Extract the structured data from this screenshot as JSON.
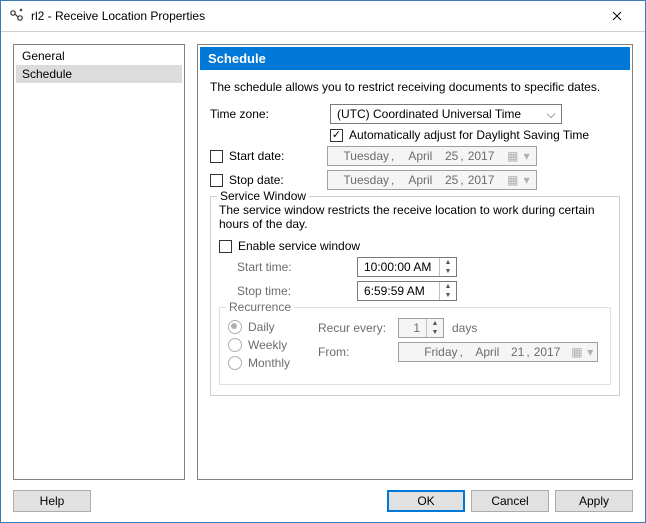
{
  "window": {
    "title": "rl2 - Receive Location Properties"
  },
  "sidebar": {
    "items": [
      {
        "label": "General",
        "selected": false
      },
      {
        "label": "Schedule",
        "selected": true
      }
    ]
  },
  "schedule": {
    "header": "Schedule",
    "description": "The schedule allows you to restrict receiving documents to specific dates.",
    "timezone": {
      "label": "Time zone:",
      "value": "(UTC) Coordinated Universal Time"
    },
    "dst": {
      "checked": true,
      "label": "Automatically adjust for Daylight Saving Time"
    },
    "startDate": {
      "checked": false,
      "label": "Start date:",
      "weekday": "Tuesday",
      "month": "April",
      "day": "25",
      "year": "2017"
    },
    "stopDate": {
      "checked": false,
      "label": "Stop date:",
      "weekday": "Tuesday",
      "month": "April",
      "day": "25",
      "year": "2017"
    },
    "serviceWindow": {
      "legend": "Service Window",
      "description": "The service window restricts the receive location to work during certain hours of the day.",
      "enableLabel": "Enable service window",
      "enabled": false,
      "startTime": {
        "label": "Start time:",
        "value": "10:00:00 AM"
      },
      "stopTime": {
        "label": "Stop time:",
        "value": "6:59:59 AM"
      }
    },
    "recurrence": {
      "legend": "Recurrence",
      "options": [
        "Daily",
        "Weekly",
        "Monthly"
      ],
      "selected": "Daily",
      "everyLabel": "Recur every:",
      "everyValue": "1",
      "everyUnit": "days",
      "fromLabel": "From:",
      "from": {
        "weekday": "Friday",
        "month": "April",
        "day": "21",
        "year": "2017"
      }
    }
  },
  "buttons": {
    "help": "Help",
    "ok": "OK",
    "cancel": "Cancel",
    "apply": "Apply"
  }
}
